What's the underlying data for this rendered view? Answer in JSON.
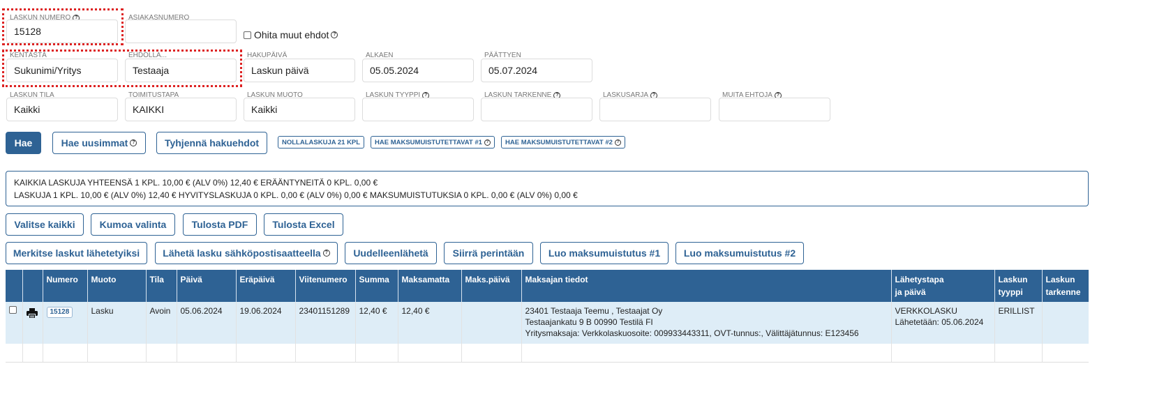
{
  "search": {
    "invoice_number": {
      "label": "LASKUN NUMERO",
      "value": "15128"
    },
    "customer_number": {
      "label": "ASIAKASNUMERO",
      "value": ""
    },
    "ignore_other": {
      "label": "Ohita muut ehdot",
      "checked": false
    },
    "field": {
      "label": "KENTÄSTÄ",
      "value": "Sukunimi/Yritys"
    },
    "condition": {
      "label": "EHDOLLA...",
      "value": "Testaaja"
    },
    "search_date": {
      "label": "HAKUPÄIVÄ",
      "value": "Laskun päivä"
    },
    "start": {
      "label": "ALKAEN",
      "value": "05.05.2024"
    },
    "end": {
      "label": "PÄÄTTYEN",
      "value": "05.07.2024"
    },
    "status": {
      "label": "LASKUN TILA",
      "value": "Kaikki"
    },
    "delivery": {
      "label": "TOIMITUSTAPA",
      "value": "KAIKKI"
    },
    "form": {
      "label": "LASKUN MUOTO",
      "value": "Kaikki"
    },
    "type": {
      "label": "LASKUN TYYPPI",
      "value": ""
    },
    "specifier": {
      "label": "LASKUN TARKENNE",
      "value": ""
    },
    "series": {
      "label": "LASKUSARJA",
      "value": ""
    },
    "other": {
      "label": "MUITA EHTOJA",
      "value": ""
    }
  },
  "buttons": {
    "search": "Hae",
    "latest": "Hae uusimmat",
    "clear": "Tyhjennä hakuehdot",
    "zero_invoices": "NOLLALASKUJA 21 KPL",
    "reminders1": "HAE MAKSUMUISTUTETTAVAT #1",
    "reminders2": "HAE MAKSUMUISTUTETTAVAT #2",
    "select_all": "Valitse kaikki",
    "undo_select": "Kumoa valinta",
    "print_pdf": "Tulosta PDF",
    "print_excel": "Tulosta Excel",
    "mark_sent": "Merkitse laskut lähetetyiksi",
    "send_email": "Lähetä lasku sähköpostisaatteella",
    "resend": "Uudelleenlähetä",
    "collection": "Siirrä perintään",
    "create_reminder1": "Luo maksumuistutus #1",
    "create_reminder2": "Luo maksumuistutus #2"
  },
  "summary": {
    "line1": "KAIKKIA LASKUJA YHTEENSÄ 1 KPL. 10,00 € (ALV 0%)  12,40 € ERÄÄNTYNEITÄ 0 KPL. 0,00 €",
    "line2": "LASKUJA 1 KPL. 10,00 € (ALV 0%)  12,40 €   HYVITYSLASKUJA 0 KPL. 0,00 € (ALV 0%)  0,00 €   MAKSUMUISTUTUKSIA 0 KPL. 0,00 € (ALV 0%)  0,00 €"
  },
  "table": {
    "headers": {
      "numero": "Numero",
      "muoto": "Muoto",
      "tila": "Tila",
      "paiva": "Päivä",
      "erapaiva": "Eräpäivä",
      "viitenumero": "Viitenumero",
      "summa": "Summa",
      "maksamatta": "Maksamatta",
      "makspaiva": "Maks.päivä",
      "maksaja": "Maksajan tiedot",
      "lahetys1": "Lähetystapa",
      "lahetys2": "ja päivä",
      "tyyppi1": "Laskun",
      "tyyppi2": "tyyppi",
      "tarkenne1": "Laskun",
      "tarkenne2": "tarkenne"
    },
    "rows": [
      {
        "numero": "15128",
        "muoto": "Lasku",
        "tila": "Avoin",
        "paiva": "05.06.2024",
        "erapaiva": "19.06.2024",
        "viitenumero": "23401151289",
        "summa": "12,40 €",
        "maksamatta": "12,40 €",
        "makspaiva": "",
        "maksaja1": "23401 Testaaja Teemu , Testaajat Oy",
        "maksaja2": "Testaajankatu 9 B 00990 Testilä FI",
        "maksaja3": "Yritysmaksaja: Verkkolaskuosoite: 009933443311, OVT-tunnus:, Välittäjätunnus: E123456",
        "lahetys1": "VERKKOLASKU",
        "lahetys2": "Lähetetään: 05.06.2024",
        "tyyppi": "ERILLIST",
        "tarkenne": ""
      }
    ]
  },
  "colors": {
    "primary": "#2e6294",
    "highlight_border": "#d22222",
    "row_bg": "#deedf7"
  }
}
